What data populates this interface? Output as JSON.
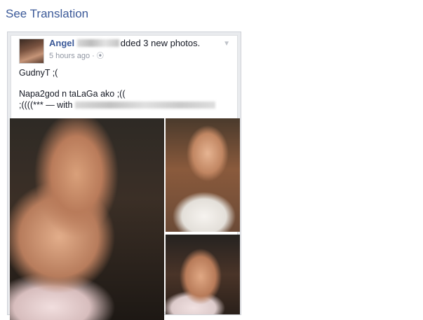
{
  "see_translation": "See Translation",
  "post": {
    "author": "Angel",
    "action": "dded 3 new photos.",
    "time": "5 hours ago",
    "audience_icon": "globe-icon",
    "menu_icon": "chevron-down-icon",
    "lines": [
      "GudnyT ;(",
      "Napa2god n taLaGa ako ;((",
      ";((((*** — with"
    ],
    "photos": [
      "photo-1",
      "photo-2",
      "photo-3"
    ]
  }
}
